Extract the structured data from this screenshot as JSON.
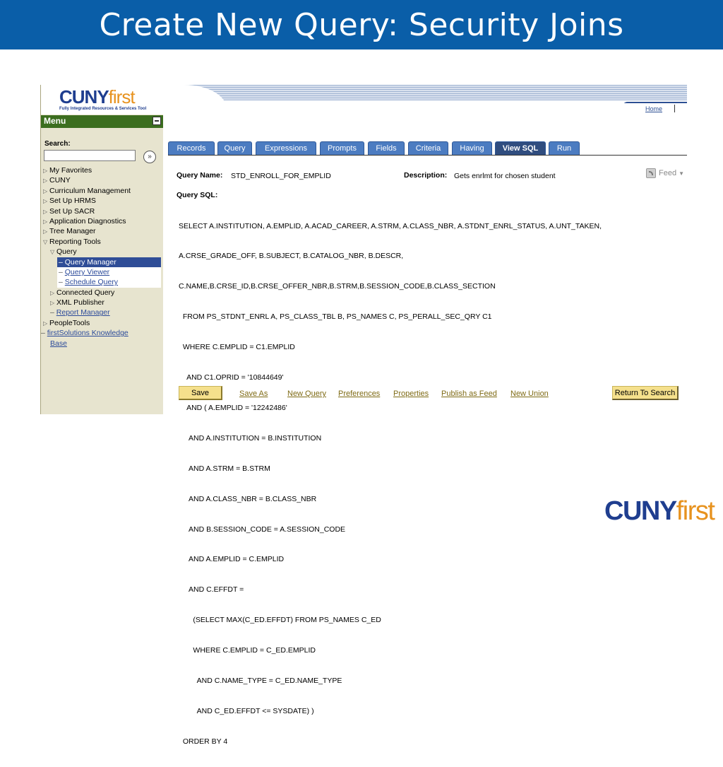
{
  "slide": {
    "title": "Create New Query: Security Joins"
  },
  "brand": {
    "logo_main": "CUNY",
    "logo_accent": "first",
    "logo_tagline": "Fully Integrated Resources & Services Tool",
    "colors": {
      "blue": "#1f3e8f",
      "orange": "#e7921e",
      "header": "#0a5ea8"
    }
  },
  "sidebar": {
    "menu_title": "Menu",
    "search_label": "Search:",
    "search_value": "",
    "items": [
      {
        "label": "My Favorites",
        "expander": "▷"
      },
      {
        "label": "CUNY",
        "expander": "▷"
      },
      {
        "label": "Curriculum Management",
        "expander": "▷"
      },
      {
        "label": "Set Up HRMS",
        "expander": "▷"
      },
      {
        "label": "Set Up SACR",
        "expander": "▷"
      },
      {
        "label": "Application Diagnostics",
        "expander": "▷"
      },
      {
        "label": "Tree Manager",
        "expander": "▷"
      },
      {
        "label": "Reporting Tools",
        "expander": "▽"
      },
      {
        "label": "Query",
        "expander": "▽"
      },
      {
        "label": "Query Manager",
        "prefix": "–"
      },
      {
        "label": "Query Viewer",
        "prefix": "–"
      },
      {
        "label": "Schedule Query",
        "prefix": "–"
      },
      {
        "label": "Connected Query",
        "expander": "▷"
      },
      {
        "label": "XML Publisher",
        "expander": "▷"
      },
      {
        "label": "Report Manager",
        "prefix": "–"
      },
      {
        "label": "PeopleTools",
        "expander": "▷"
      },
      {
        "label": "firstSolutions Knowledge",
        "prefix": "–"
      },
      {
        "label": "Base"
      }
    ]
  },
  "header": {
    "home_link": "Home"
  },
  "tabs": [
    {
      "label": "Records"
    },
    {
      "label": "Query"
    },
    {
      "label": "Expressions"
    },
    {
      "label": "Prompts"
    },
    {
      "label": "Fields"
    },
    {
      "label": "Criteria"
    },
    {
      "label": "Having"
    },
    {
      "label": "View SQL"
    },
    {
      "label": "Run"
    }
  ],
  "query": {
    "name_label": "Query Name:",
    "name_value": "STD_ENROLL_FOR_EMPLID",
    "description_label": "Description:",
    "description_value": "Gets enrlmt for chosen student",
    "feed_label": "Feed",
    "sql_label": "Query SQL:",
    "sql_lines": [
      "SELECT A.INSTITUTION, A.EMPLID, A.ACAD_CAREER, A.STRM, A.CLASS_NBR, A.STDNT_ENRL_STATUS, A.UNT_TAKEN,",
      "A.CRSE_GRADE_OFF, B.SUBJECT, B.CATALOG_NBR, B.DESCR,",
      "C.NAME,B.CRSE_ID,B.CRSE_OFFER_NBR,B.STRM,B.SESSION_CODE,B.CLASS_SECTION",
      "  FROM PS_STDNT_ENRL A, PS_CLASS_TBL B, PS_NAMES C, PS_PERALL_SEC_QRY C1",
      "  WHERE C.EMPLID = C1.EMPLID",
      "    AND C1.OPRID = '10844649'",
      "    AND ( A.EMPLID = '12242486'",
      "     AND A.INSTITUTION = B.INSTITUTION",
      "     AND A.STRM = B.STRM",
      "     AND A.CLASS_NBR = B.CLASS_NBR",
      "     AND B.SESSION_CODE = A.SESSION_CODE",
      "     AND A.EMPLID = C.EMPLID",
      "     AND C.EFFDT =",
      "       (SELECT MAX(C_ED.EFFDT) FROM PS_NAMES C_ED",
      "       WHERE C.EMPLID = C_ED.EMPLID",
      "         AND C.NAME_TYPE = C_ED.NAME_TYPE",
      "         AND C_ED.EFFDT <= SYSDATE) )",
      "  ORDER BY 4"
    ]
  },
  "actions": {
    "save": "Save",
    "save_as": "Save As",
    "new_query": "New Query",
    "preferences": "Preferences",
    "properties": "Properties",
    "publish_as_feed": "Publish as Feed",
    "new_union": "New Union",
    "return_to_search": "Return To Search"
  }
}
